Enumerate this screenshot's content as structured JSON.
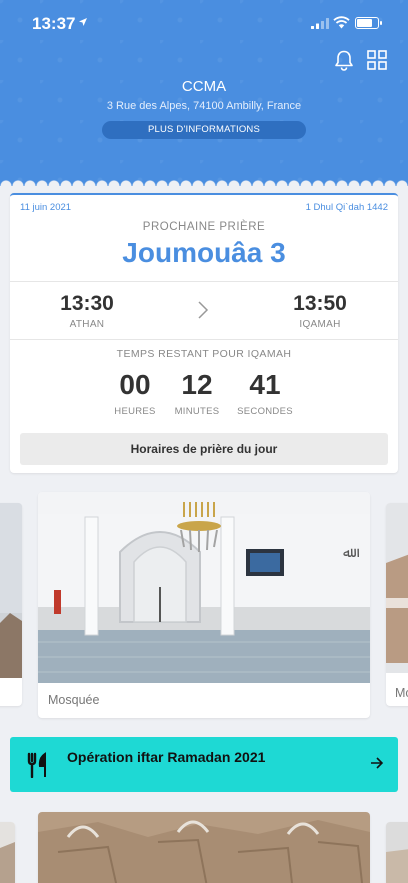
{
  "status_bar": {
    "time": "13:37"
  },
  "header": {
    "org_name": "CCMA",
    "address": "3 Rue des Alpes, 74100 Ambilly, France",
    "more_info_label": "PLUS D'INFORMATIONS"
  },
  "prayer": {
    "date_gregorian": "11 juin 2021",
    "date_hijri": "1 Dhul Qi`dah 1442",
    "next_label": "PROCHAINE PRIÈRE",
    "next_name": "Joumouâa 3",
    "athan_time": "13:30",
    "athan_label": "ATHAN",
    "iqamah_time": "13:50",
    "iqamah_label": "IQAMAH",
    "remaining_label": "TEMPS RESTANT POUR IQAMAH",
    "countdown": {
      "hours": "00",
      "hours_label": "HEURES",
      "minutes": "12",
      "minutes_label": "MINUTES",
      "seconds": "41",
      "seconds_label": "SECONDES"
    },
    "day_times_button": "Horaires de prière du jour"
  },
  "carousel": {
    "main_caption": "Mosquée",
    "right_caption_partial": "Mo"
  },
  "banner": {
    "text": "Opération iftar Ramadan 2021"
  },
  "colors": {
    "header_blue": "#4a8ee0",
    "accent_blue": "#4a8ee0",
    "banner_cyan": "#1ed9d4"
  }
}
